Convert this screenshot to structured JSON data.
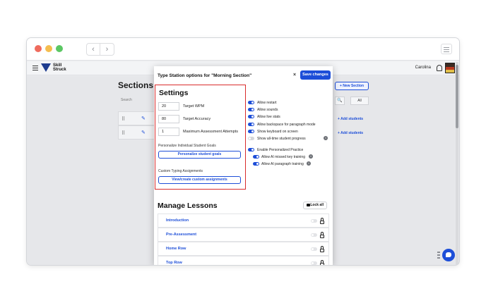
{
  "app": {
    "logo_text": "Skill Struck",
    "user_name": "Carolina"
  },
  "background": {
    "sections_title": "Sections",
    "search_label": "Search",
    "new_section": "+ New Section",
    "filter_all": "All",
    "add_students": "+ Add students"
  },
  "modal": {
    "title": "Type Station options for \"Morning Section\"",
    "close": "×",
    "save": "Save changes",
    "settings": {
      "title": "Settings",
      "target_wpm_value": "20",
      "target_wpm_label": "Target WPM",
      "target_accuracy_value": "80",
      "target_accuracy_label": "Target Accuracy",
      "max_attempts_value": "1",
      "max_attempts_label": "Maximum Assessment Attempts",
      "personalize_heading": "Personalize Individual Student Goals",
      "personalize_button": "Personalize student goals",
      "custom_heading": "Custom Typing Assignments",
      "custom_button": "View/create custom assignments"
    },
    "options": [
      {
        "label": "Allow restart",
        "on": true
      },
      {
        "label": "Allow sounds",
        "on": true
      },
      {
        "label": "Allow live stats",
        "on": true
      },
      {
        "label": "Allow backspace for paragraph mode",
        "on": true
      },
      {
        "label": "Show keyboard on screen",
        "on": true
      },
      {
        "label": "Show all-time student progress",
        "on": false
      }
    ],
    "personalized": {
      "label": "Enable Personalized Practice",
      "missed_key": "Allow AI missed key training",
      "paragraph": "Allow AI paragraph training"
    },
    "manage": {
      "title": "Manage Lessons",
      "lock_all": "Lock all",
      "lessons": [
        "Introduction",
        "Pre-Assessment",
        "Home Row",
        "Top Row"
      ]
    }
  },
  "colors": {
    "accent": "#1d4ed8",
    "highlight": "#d92b2b"
  },
  "icons": {
    "info": "i",
    "back": "‹",
    "forward": "›",
    "drag": "⠿",
    "edit": "✎",
    "search": "🔍"
  }
}
